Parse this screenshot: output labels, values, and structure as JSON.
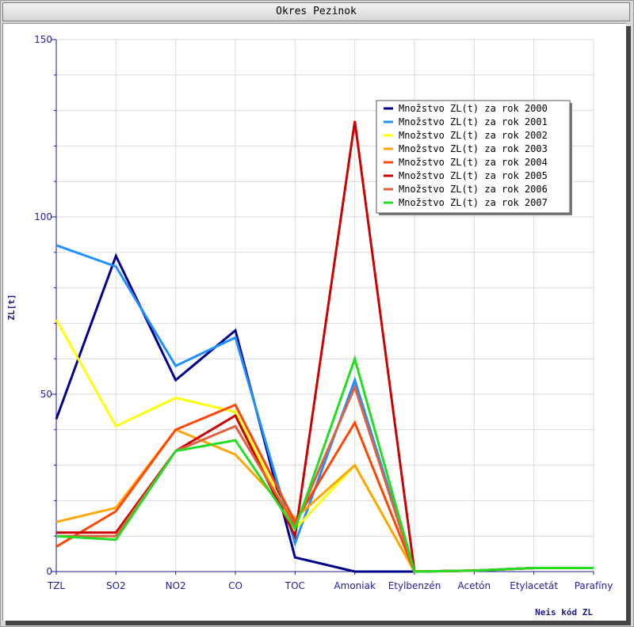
{
  "window": {
    "title": "Okres Pezinok"
  },
  "chart_data": {
    "type": "line",
    "title": "Okres Pezinok",
    "xlabel": "Neis kód ZL",
    "ylabel": "ZL[t]",
    "categories": [
      "TZL",
      "SO2",
      "NO2",
      "CO",
      "TOC",
      "Amoniak",
      "Etylbenzén",
      "Acetón",
      "Etylacetát",
      "Parafíny"
    ],
    "ylim": [
      0,
      150
    ],
    "yticks": [
      0,
      50,
      100,
      150
    ],
    "grid": true,
    "legend_position": "top-right",
    "series": [
      {
        "name": "Množstvo ZL(t) za rok 2000",
        "color": "#00008b",
        "values": [
          43,
          89,
          54,
          68,
          4,
          0,
          0,
          0.3,
          1,
          1
        ]
      },
      {
        "name": "Množstvo ZL(t) za rok 2001",
        "color": "#1e90ff",
        "values": [
          92,
          86,
          58,
          66,
          8,
          54,
          0,
          0.3,
          1,
          1
        ]
      },
      {
        "name": "Množstvo ZL(t) za rok 2002",
        "color": "#ffff00",
        "values": [
          71,
          41,
          49,
          45,
          12,
          30,
          0,
          0.3,
          1,
          1
        ]
      },
      {
        "name": "Množstvo ZL(t) za rok 2003",
        "color": "#ffa500",
        "values": [
          14,
          18,
          40,
          33,
          15,
          30,
          0,
          0.3,
          1,
          1
        ]
      },
      {
        "name": "Množstvo ZL(t) za rok 2004",
        "color": "#ff4500",
        "values": [
          7,
          17,
          40,
          47,
          14,
          42,
          0,
          0.3,
          1,
          1
        ]
      },
      {
        "name": "Množstvo ZL(t) za rok 2005",
        "color": "#cc0000",
        "values": [
          11,
          11,
          34,
          44,
          10,
          127,
          0,
          0.3,
          1,
          1
        ]
      },
      {
        "name": "Množstvo ZL(t) za rok 2006",
        "color": "#e06040",
        "values": [
          10,
          10,
          34,
          41,
          13,
          52,
          0,
          0.3,
          1,
          1
        ]
      },
      {
        "name": "Množstvo ZL(t) za rok 2007",
        "color": "#22dd22",
        "values": [
          10,
          9,
          34,
          37,
          12,
          60,
          0,
          0.3,
          1,
          1
        ]
      }
    ]
  }
}
